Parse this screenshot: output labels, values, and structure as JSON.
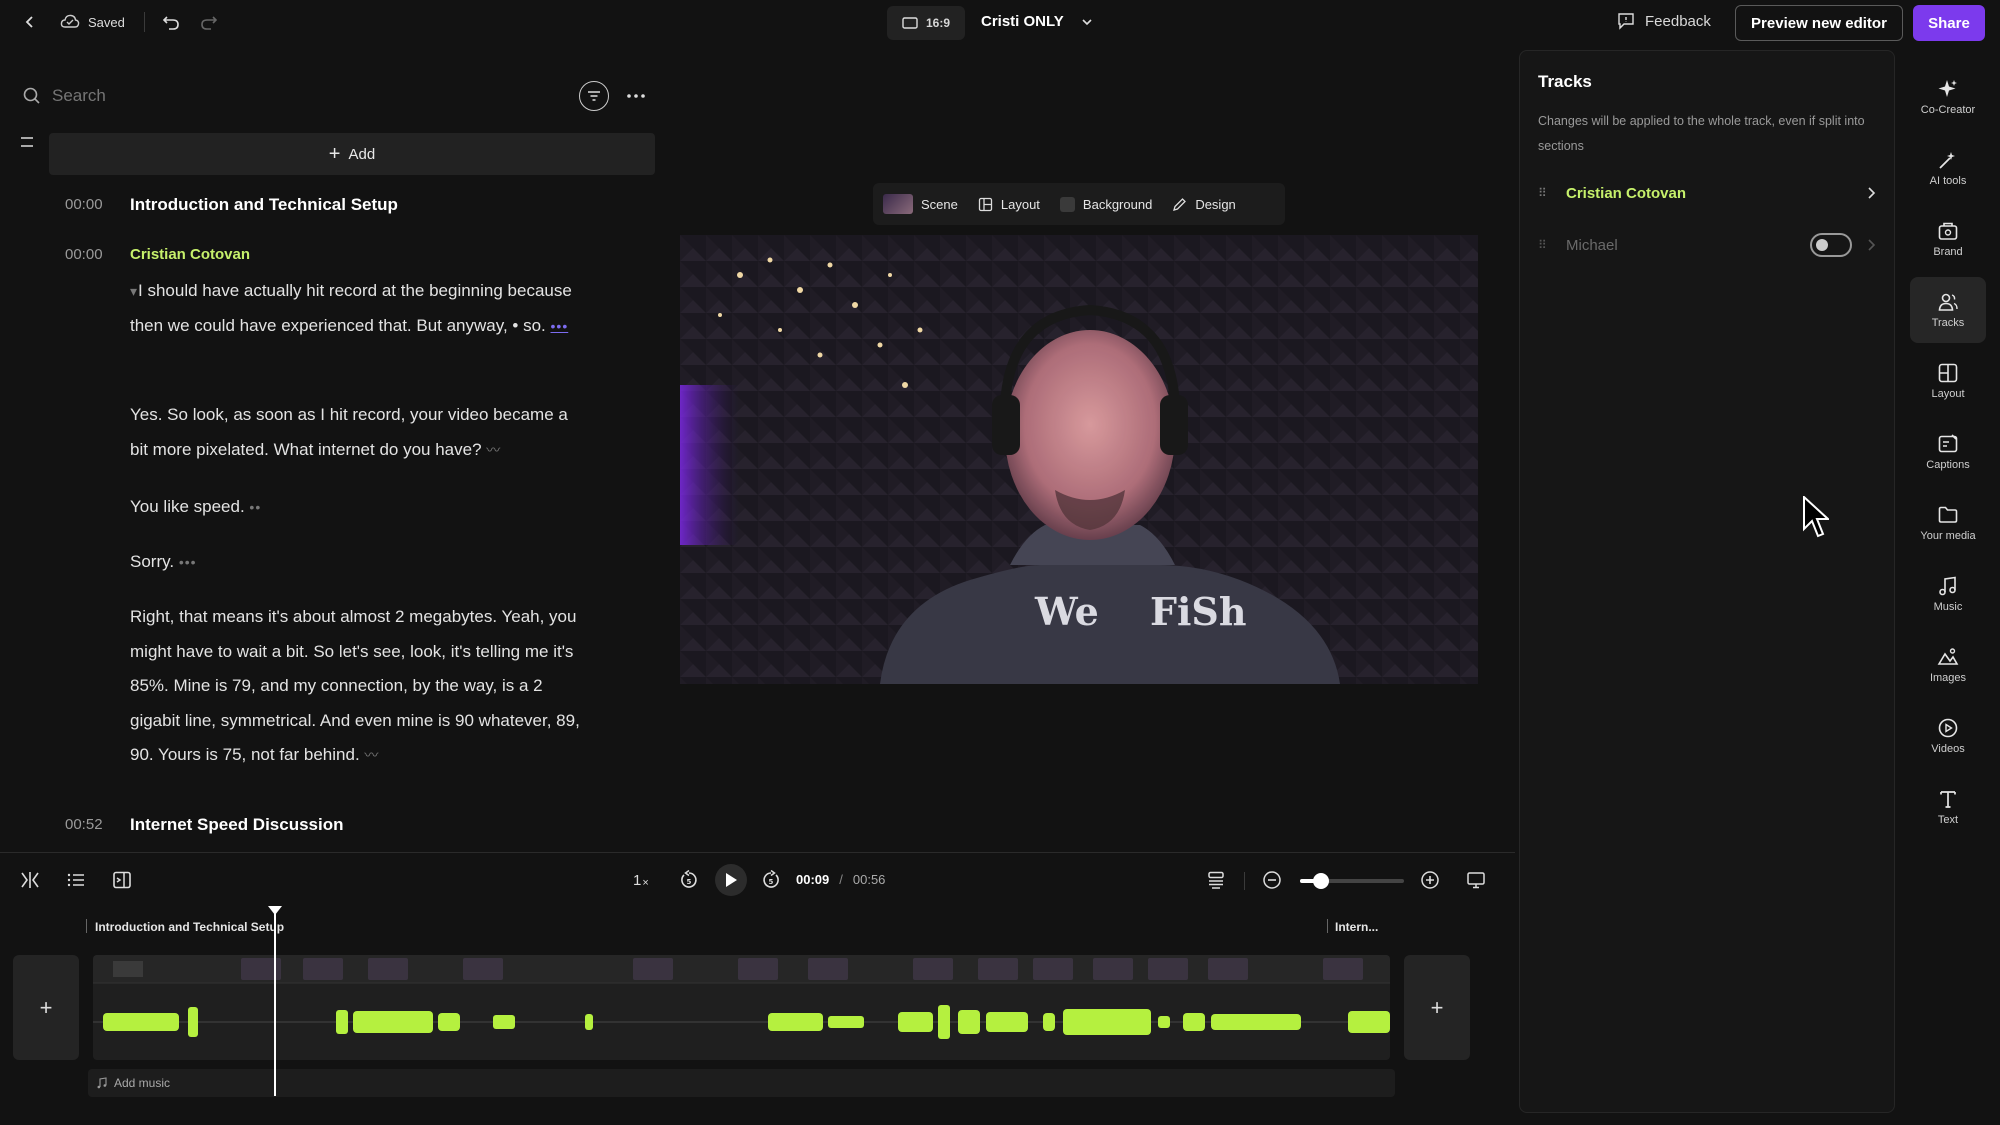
{
  "topbar": {
    "saved_label": "Saved",
    "aspect_label": "16:9",
    "project_name": "Cristi ONLY",
    "feedback_label": "Feedback",
    "preview_label": "Preview new editor",
    "share_label": "Share"
  },
  "transcript": {
    "search_placeholder": "Search",
    "add_label": "Add",
    "sections": [
      {
        "time": "00:00",
        "title": "Introduction and Technical Setup"
      },
      {
        "time": "00:52",
        "title": "Internet Speed Discussion"
      }
    ],
    "speaker": {
      "time": "00:00",
      "name": "Cristian Cotovan"
    },
    "paragraphs": [
      "I should have actually hit record at the beginning because then we could have experienced that. But anyway, • so.",
      "Yes. So look, as soon as I hit record, your video became a bit more pixelated. What internet do you have?",
      "You like speed.",
      "Sorry.",
      "Right, that means it's about almost 2 megabytes. Yeah, you might have to wait a bit. So let's see, look, it's telling me it's 85%. Mine is 79, and my connection, by the way, is a 2 gigabit line, symmetrical. And even mine is 90 whatever, 89, 90. Yours is 75, not far behind."
    ]
  },
  "scene_toolbar": {
    "scene": "Scene",
    "layout": "Layout",
    "background": "Background",
    "design": "Design"
  },
  "video": {
    "shirt_text_left": "We",
    "shirt_text_right": "FiSh"
  },
  "tracks_panel": {
    "title": "Tracks",
    "description": "Changes will be applied to the whole track, even if split into sections",
    "tracks": [
      {
        "name": "Cristian Cotovan",
        "enabled": true
      },
      {
        "name": "Michael",
        "enabled": false
      }
    ]
  },
  "rail": [
    {
      "label": "Co-Creator",
      "icon": "sparkle-icon"
    },
    {
      "label": "AI tools",
      "icon": "magic-wand-icon"
    },
    {
      "label": "Brand",
      "icon": "brand-kit-icon"
    },
    {
      "label": "Tracks",
      "icon": "people-icon"
    },
    {
      "label": "Layout",
      "icon": "layout-icon"
    },
    {
      "label": "Captions",
      "icon": "captions-icon"
    },
    {
      "label": "Your media",
      "icon": "folder-icon"
    },
    {
      "label": "Music",
      "icon": "music-note-icon"
    },
    {
      "label": "Images",
      "icon": "image-icon"
    },
    {
      "label": "Videos",
      "icon": "play-circle-icon"
    },
    {
      "label": "Text",
      "icon": "text-icon"
    }
  ],
  "player": {
    "speed": "1",
    "current_time": "00:09",
    "separator": "/",
    "total_time": "00:56",
    "zoom_level": 0.2
  },
  "timeline": {
    "chapter_1": "Introduction and Technical Setup",
    "chapter_2": "Intern...",
    "add_music_label": "Add music"
  },
  "colors": {
    "accent": "#7c3aed",
    "speaker": "#c6f06b",
    "waveform": "#b5f03f",
    "background": "#121212"
  }
}
